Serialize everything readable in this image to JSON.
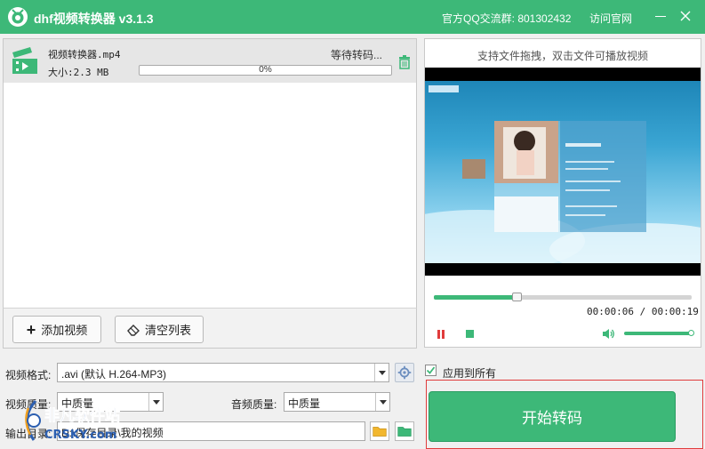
{
  "titlebar": {
    "app_title": "dhf视频转换器 v3.1.3",
    "qq_group": "官方QQ交流群: 801302432",
    "visit_site": "访问官网",
    "close_glyph": "✕",
    "accent_color": "#3db878"
  },
  "file_list": {
    "items": [
      {
        "name": "视频转换器.mp4",
        "size": "大小:2.3 MB",
        "status": "等待转码...",
        "progress": "0%",
        "progress_value": 0
      }
    ],
    "add_button": "添加视频",
    "clear_button": "清空列表"
  },
  "preview": {
    "hint": "支持文件拖拽，双击文件可播放视频",
    "current_time": "00:00:06",
    "total_time": "00:00:19",
    "time_display": "00:00:06 / 00:00:19",
    "position_fraction": 0.32,
    "volume_fraction": 1.0
  },
  "settings": {
    "format_label": "视频格式:",
    "format_value": ".avi (默认 H.264-MP3)",
    "video_quality_label": "视频质量:",
    "video_quality_value": "中质量",
    "audio_quality_label": "音频质量:",
    "audio_quality_value": "中质量",
    "output_label": "输出目录:",
    "output_value": "D:\\保存目录\\我的视频",
    "apply_all_label": "应用到所有",
    "apply_all_checked": true,
    "start_button": "开始转码"
  },
  "watermark": {
    "line1": "非凡软件站",
    "line2": "CRSKY.com"
  }
}
